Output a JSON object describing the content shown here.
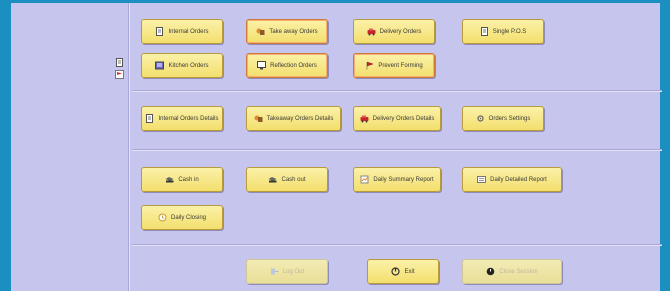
{
  "colors": {
    "frame": "#1a8fc0",
    "panel": "#c6c5ee",
    "button_face": "#f7e98a",
    "button_border": "#b89a3a"
  },
  "side_icons": [
    "document-icon",
    "flag-icon"
  ],
  "orders": [
    {
      "label": "Internal Orders",
      "icon": "document-icon"
    },
    {
      "label": "Take away Orders",
      "icon": "takeaway-icon"
    },
    {
      "label": "Delivery Orders",
      "icon": "car-icon"
    },
    {
      "label": "Single P.O.S",
      "icon": "document-icon"
    },
    {
      "label": "Kitchen Orders",
      "icon": "kitchen-icon"
    },
    {
      "label": "Reflection Orders",
      "icon": "monitor-icon"
    },
    {
      "label": "Prevent Forming",
      "icon": "flag-icon"
    }
  ],
  "details": [
    {
      "label": "Internal Orders Details",
      "icon": "document-icon"
    },
    {
      "label": "Takeaway Orders Details",
      "icon": "takeaway-icon"
    },
    {
      "label": "Delivery Orders Details",
      "icon": "car-icon"
    },
    {
      "label": "Orders Settings",
      "icon": "settings-icon"
    }
  ],
  "cash": [
    {
      "label": "Cash in",
      "icon": "cash-drawer-icon"
    },
    {
      "label": "Cash out",
      "icon": "cash-drawer-icon"
    },
    {
      "label": "Daily Summary Report",
      "icon": "report-icon"
    },
    {
      "label": "Daily Detailed Report",
      "icon": "report-icon"
    },
    {
      "label": "Daily Closing",
      "icon": "clock-icon"
    }
  ],
  "footer": [
    {
      "label": "Log Out",
      "icon": "logout-icon",
      "enabled": false
    },
    {
      "label": "Exit",
      "icon": "exit-icon",
      "enabled": true
    },
    {
      "label": "Close Session",
      "icon": "power-icon",
      "enabled": false
    }
  ]
}
